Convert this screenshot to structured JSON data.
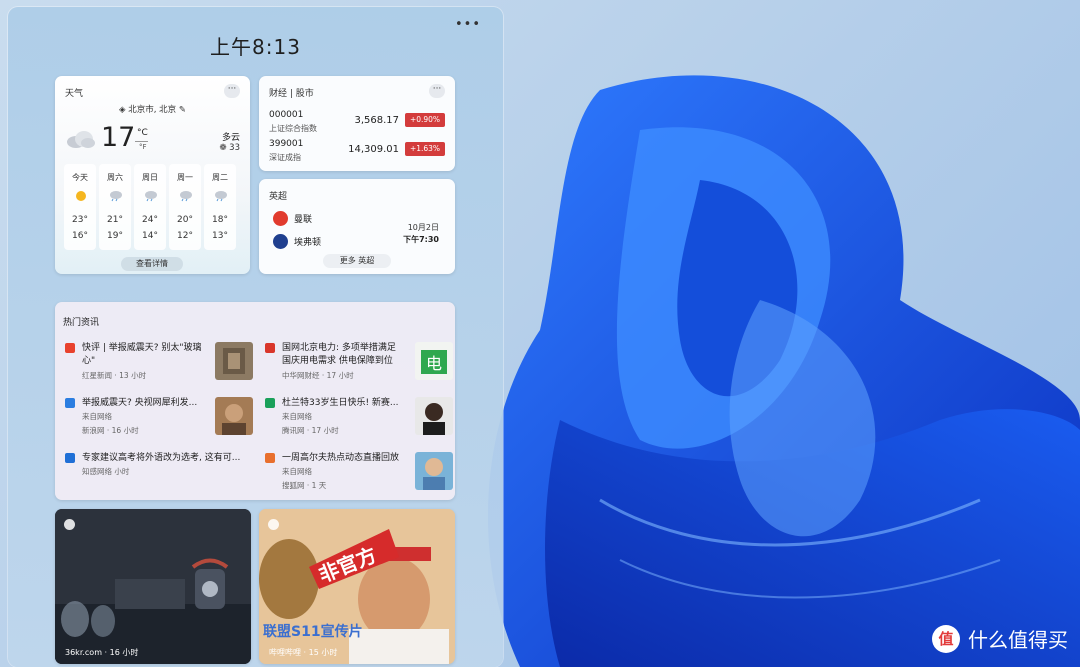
{
  "time": "上午8:13",
  "weather": {
    "title": "天气",
    "location": "北京市, 北京",
    "temp": "17",
    "unit_c": "°C",
    "unit_f": "°F",
    "condition": "多云",
    "aqi": "33",
    "days": [
      {
        "name": "今天",
        "icon": "sun-icon",
        "high": "23°",
        "low": "16°"
      },
      {
        "name": "周六",
        "icon": "rain-cloud-icon",
        "high": "21°",
        "low": "19°"
      },
      {
        "name": "周日",
        "icon": "rain-cloud-icon",
        "high": "24°",
        "low": "14°"
      },
      {
        "name": "周一",
        "icon": "rain-cloud-icon",
        "high": "20°",
        "low": "12°"
      },
      {
        "name": "周二",
        "icon": "rain-cloud-icon",
        "high": "18°",
        "low": "13°"
      }
    ],
    "details_button": "查看详情"
  },
  "finance": {
    "title": "财经 | 股市",
    "stocks": [
      {
        "code": "000001",
        "name": "上证综合指数",
        "value": "3,568.17",
        "change": "+0.90%"
      },
      {
        "code": "399001",
        "name": "深证成指",
        "value": "14,309.01",
        "change": "+1.63%"
      }
    ],
    "up_color": "#d33c3c"
  },
  "sports": {
    "title": "英超",
    "home": "曼联",
    "away": "埃弗顿",
    "date": "10月2日",
    "time": "下午7:30",
    "more_button": "更多 英超"
  },
  "news": {
    "title": "热门资讯",
    "items": [
      {
        "headline": "快评 | 举报威震天? 别太\"玻璃心\"",
        "source": "红星新闻 · 13 小时"
      },
      {
        "headline": "国网北京电力: 多项举措满足国庆用电需求 供电保障到位",
        "source": "中华网财经 · 17 小时"
      },
      {
        "headline": "举报威震天? 央视网犀利发...",
        "via": "来自网络",
        "source": "新浪网 · 16 小时"
      },
      {
        "headline": "杜兰特33岁生日快乐! 新赛...",
        "via": "来自网络",
        "source": "腾讯网 · 17 小时"
      },
      {
        "headline": "专家建议高考将外语改为选考, 这有可...",
        "source": "知感网络 小时"
      },
      {
        "headline": "一周高尔夫热点动态直播回放",
        "via": "来自网络",
        "source": "搜狐网 · 1 天"
      }
    ]
  },
  "feed": [
    {
      "source": "36kr.com · 16 小时"
    },
    {
      "source": "哔哩哔哩 · 15 小时",
      "overlay1": "非官方",
      "overlay2": "联盟S11宣传片"
    }
  ],
  "watermark": "什么值得买"
}
